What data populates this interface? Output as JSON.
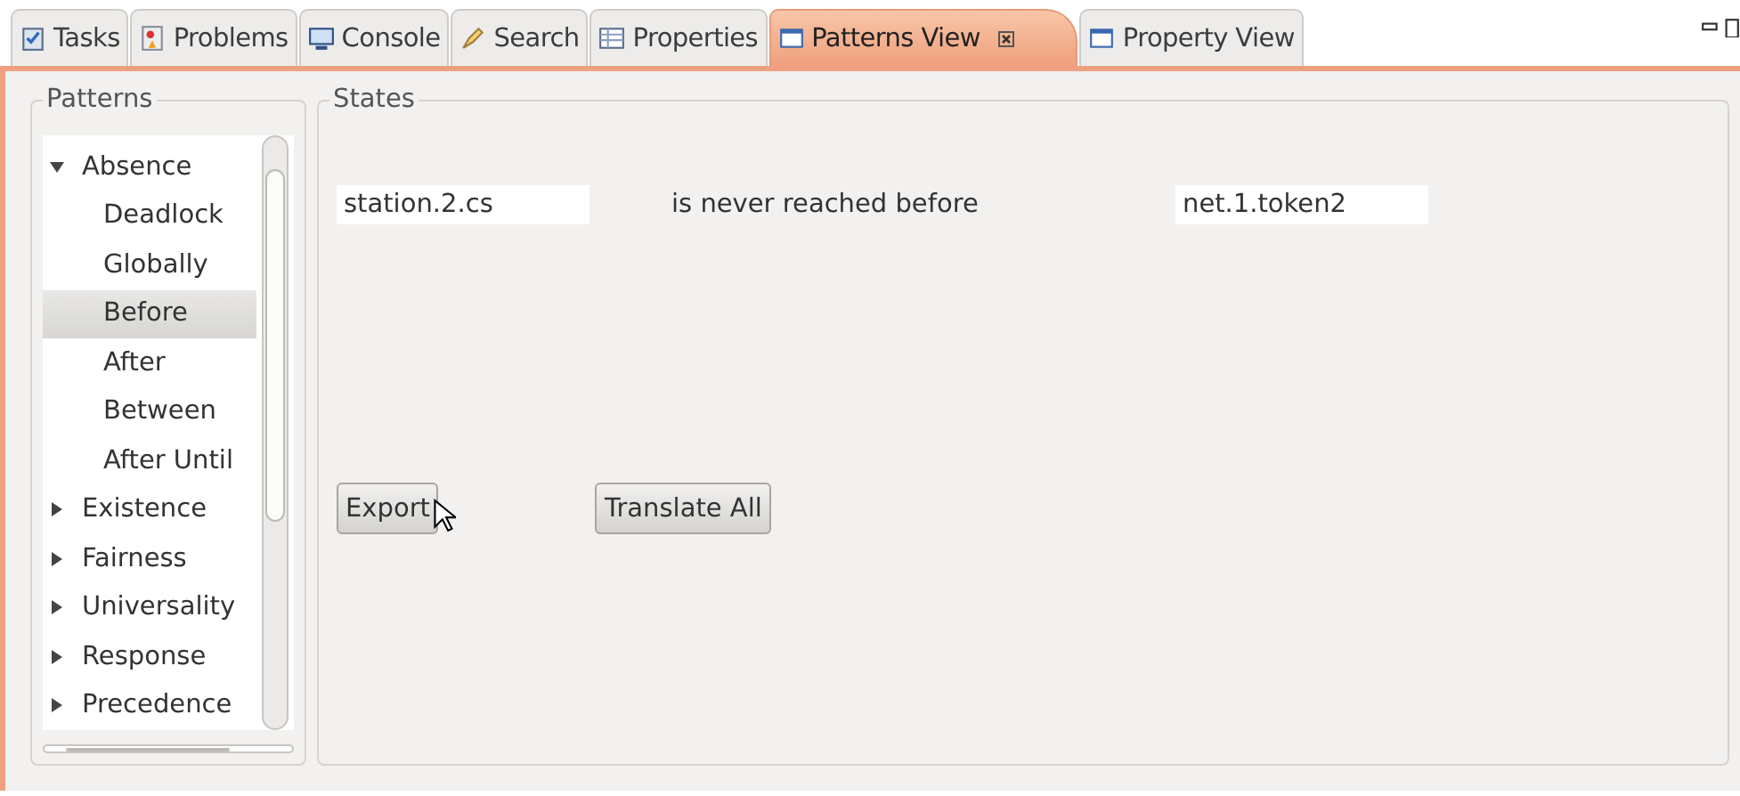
{
  "tabs": [
    {
      "label": "Tasks",
      "kind": "tasks",
      "selected": false
    },
    {
      "label": "Problems",
      "kind": "problems",
      "selected": false
    },
    {
      "label": "Console",
      "kind": "console",
      "selected": false
    },
    {
      "label": "Search",
      "kind": "search",
      "selected": false
    },
    {
      "label": "Properties",
      "kind": "properties",
      "selected": false
    },
    {
      "label": "Patterns View",
      "kind": "view",
      "selected": true
    },
    {
      "label": "Property View",
      "kind": "view",
      "selected": false
    }
  ],
  "patterns": {
    "title": "Patterns",
    "items": [
      {
        "label": "Absence",
        "expanded": true,
        "selected": false,
        "children": [
          {
            "label": "Deadlock",
            "selected": false
          },
          {
            "label": "Globally",
            "selected": false
          },
          {
            "label": "Before",
            "selected": true
          },
          {
            "label": "After",
            "selected": false
          },
          {
            "label": "Between",
            "selected": false
          },
          {
            "label": "After Until",
            "selected": false
          }
        ]
      },
      {
        "label": "Existence",
        "expanded": false,
        "selected": false
      },
      {
        "label": "Fairness",
        "expanded": false,
        "selected": false
      },
      {
        "label": "Universality",
        "expanded": false,
        "selected": false
      },
      {
        "label": "Response",
        "expanded": false,
        "selected": false
      },
      {
        "label": "Precedence",
        "expanded": false,
        "selected": false
      }
    ]
  },
  "states": {
    "title": "States",
    "field_1": "station.2.cs",
    "text": "is never reached before",
    "field_2": "net.1.token2",
    "buttons": [
      "Export",
      "Translate All"
    ]
  }
}
